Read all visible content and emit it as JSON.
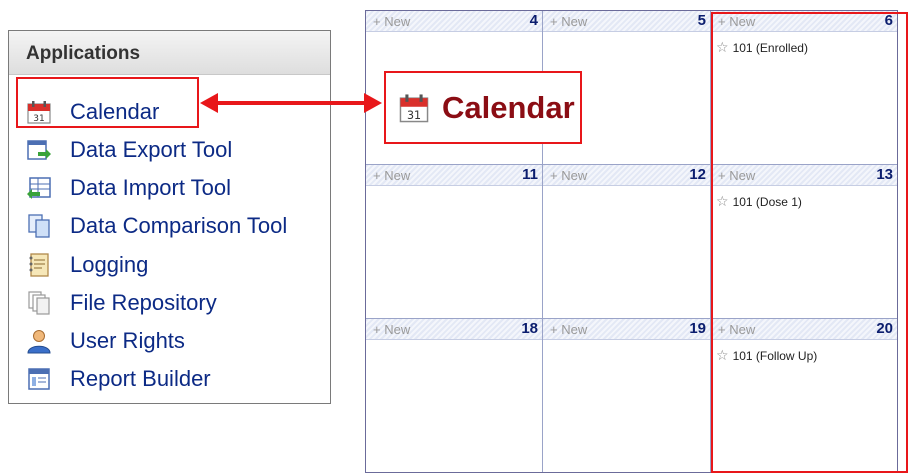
{
  "applications": {
    "title": "Applications",
    "items": [
      {
        "label": "Calendar",
        "icon": "calendar-icon"
      },
      {
        "label": "Data Export Tool",
        "icon": "data-export-icon"
      },
      {
        "label": "Data Import Tool",
        "icon": "data-import-icon"
      },
      {
        "label": "Data Comparison Tool",
        "icon": "data-comparison-icon"
      },
      {
        "label": "Logging",
        "icon": "logging-icon"
      },
      {
        "label": "File Repository",
        "icon": "file-repository-icon"
      },
      {
        "label": "User Rights",
        "icon": "user-rights-icon"
      },
      {
        "label": "Report Builder",
        "icon": "report-builder-icon"
      }
    ]
  },
  "callout": {
    "title": "Calendar",
    "icon": "calendar-icon"
  },
  "calendar": {
    "new_label": "+ New",
    "rows": [
      [
        {
          "day": "4"
        },
        {
          "day": "5"
        },
        {
          "day": "6",
          "event": "101 (Enrolled)"
        }
      ],
      [
        {
          "day": "11"
        },
        {
          "day": "12"
        },
        {
          "day": "13",
          "event": "101 (Dose 1)"
        }
      ],
      [
        {
          "day": "18"
        },
        {
          "day": "19"
        },
        {
          "day": "20",
          "event": "101 (Follow Up)"
        }
      ]
    ]
  },
  "colors": {
    "highlight": "#e8171a",
    "link": "#0c2a85",
    "title_red": "#8b0d14",
    "day_number": "#0b1d6e"
  }
}
